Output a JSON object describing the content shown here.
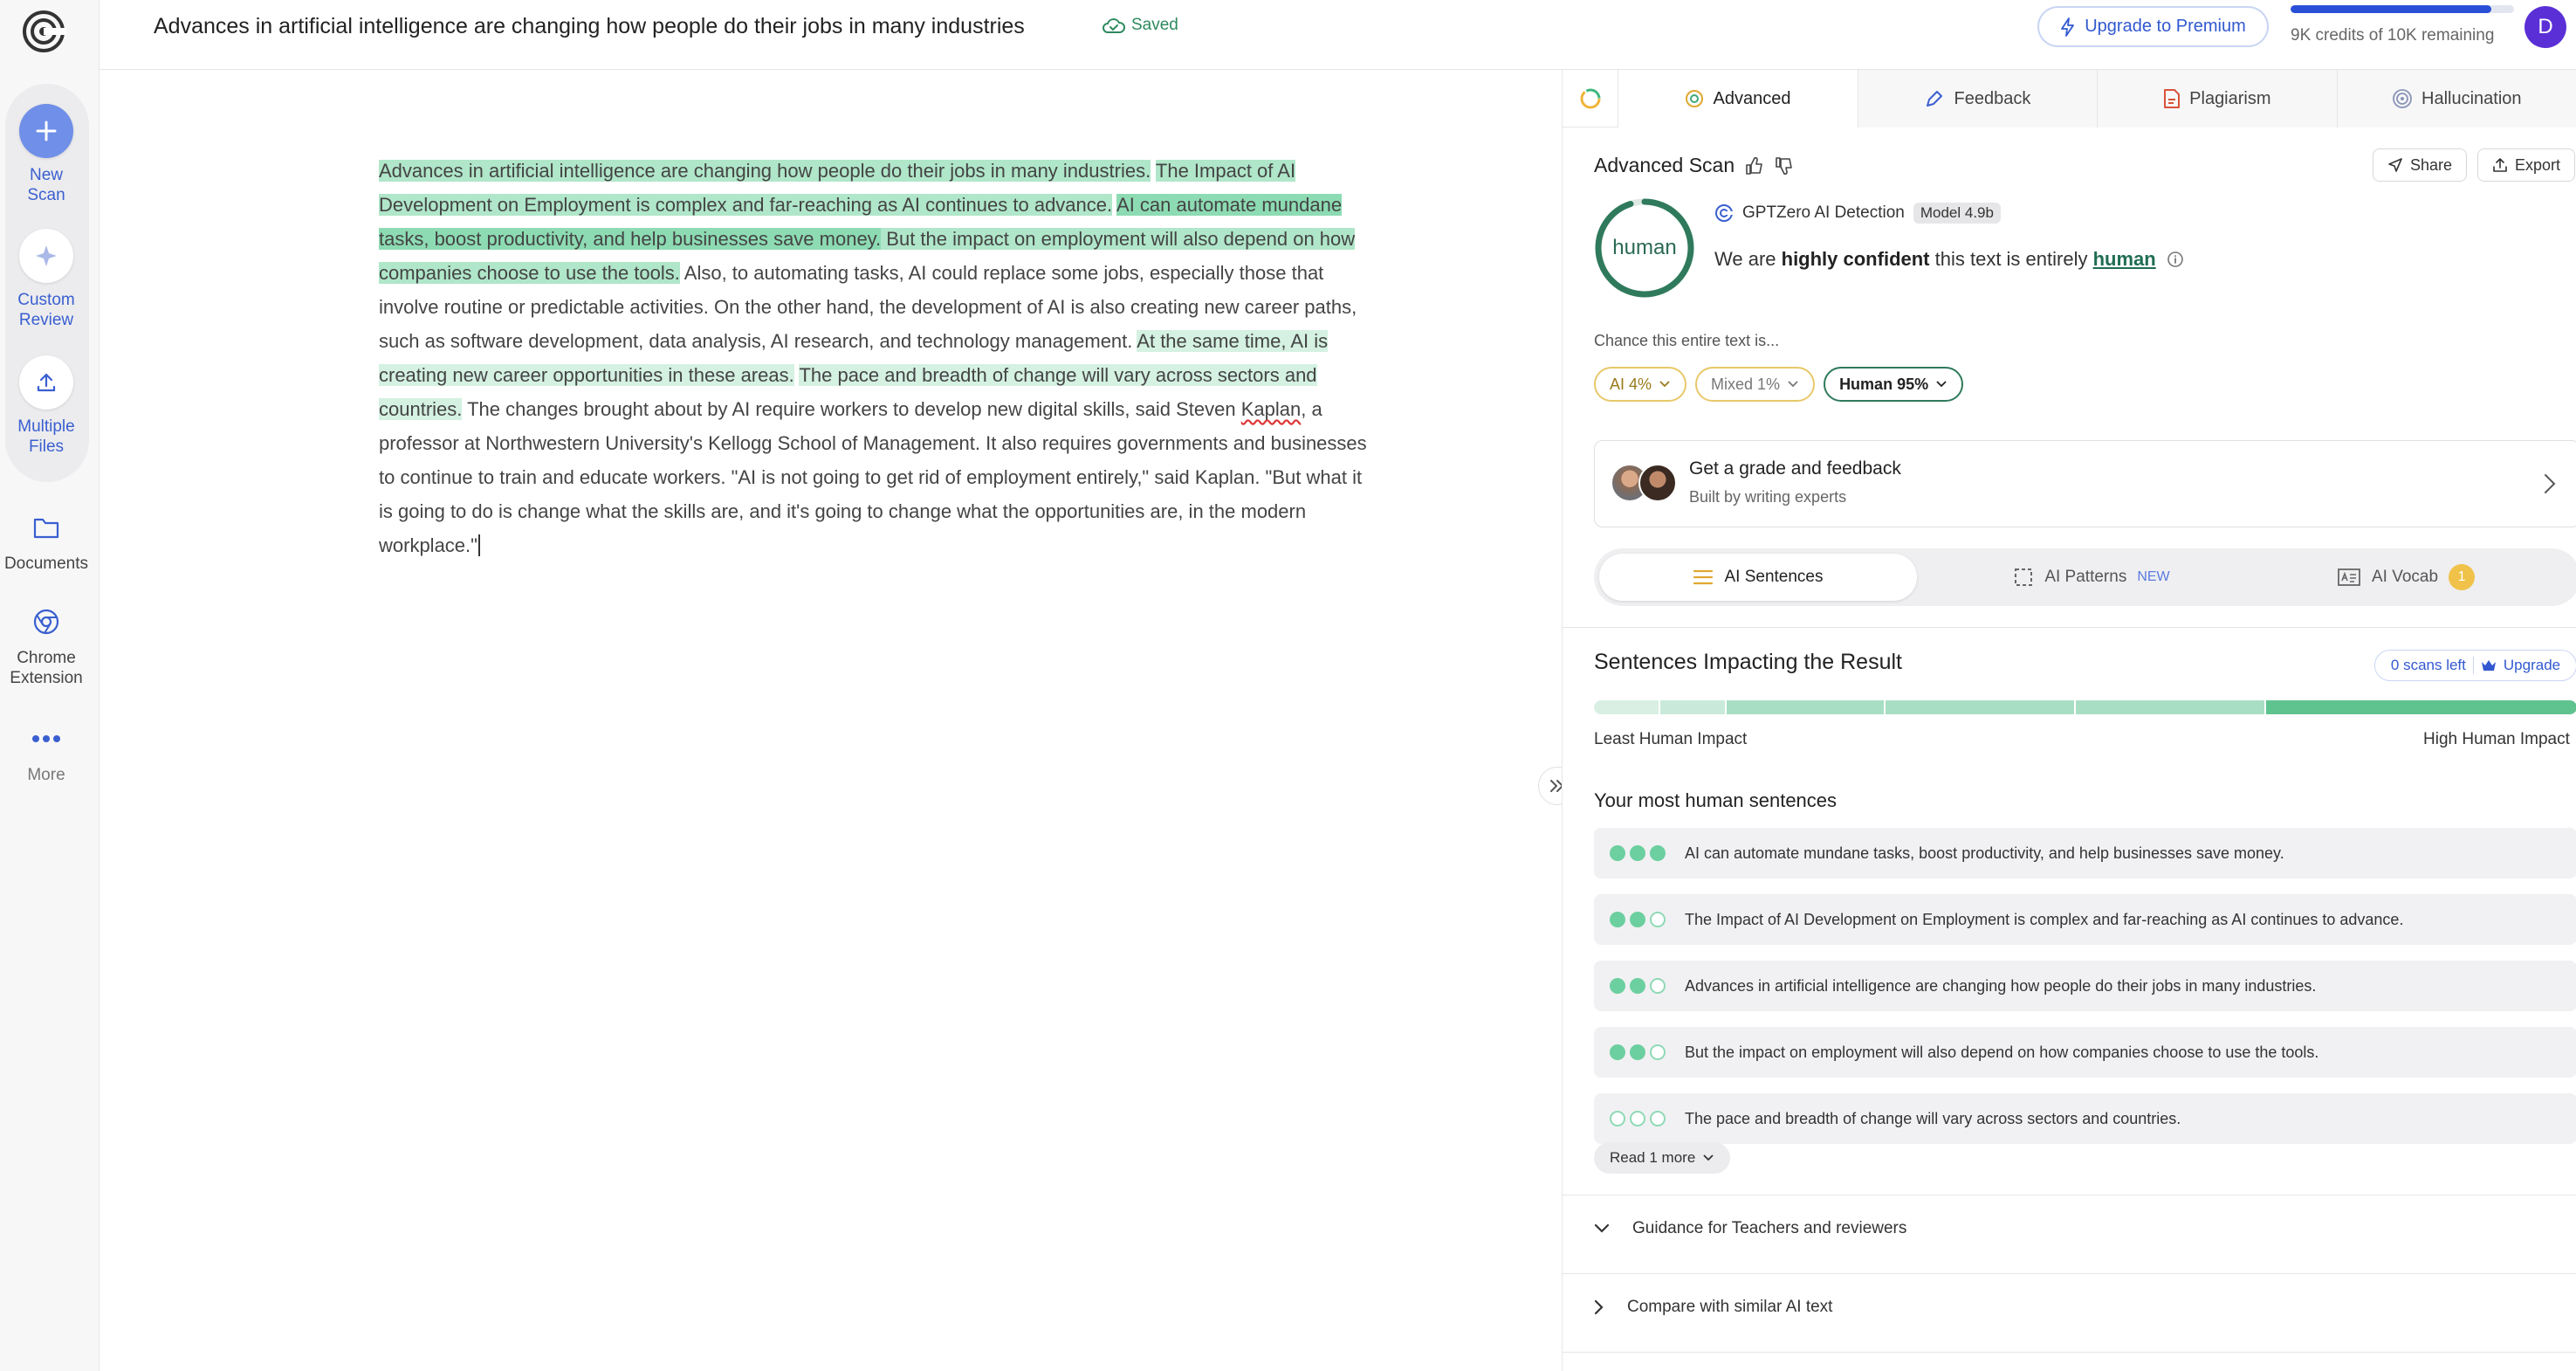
{
  "document": {
    "title": "Advances in artificial intelligence are changing how people do their jobs in many industries",
    "saved_label": "Saved"
  },
  "sidebar": {
    "items": [
      {
        "label_line1": "New",
        "label_line2": "Scan",
        "icon": "plus-icon"
      },
      {
        "label_line1": "Custom",
        "label_line2": "Review",
        "icon": "sparkle-icon"
      },
      {
        "label_line1": "Multiple",
        "label_line2": "Files",
        "icon": "upload-icon"
      },
      {
        "label_line1": "Documents",
        "label_line2": "",
        "icon": "folder-icon"
      },
      {
        "label_line1": "Chrome",
        "label_line2": "Extension",
        "icon": "chrome-icon"
      },
      {
        "label_line1": "More",
        "label_line2": "",
        "icon": "more-dots-icon"
      }
    ]
  },
  "header": {
    "upgrade_label": "Upgrade to Premium",
    "credits_text": "9K credits of 10K remaining",
    "credits_fraction": 0.9,
    "avatar_initial": "D"
  },
  "editor": {
    "segments": [
      {
        "text": "Advances in artificial intelligence are changing how people do their jobs in many industries.",
        "hl": "mid"
      },
      {
        "text": " ",
        "hl": "none"
      },
      {
        "text": "The Impact of AI Development on Employment is complex and far-reaching as AI continues to advance.",
        "hl": "mid"
      },
      {
        "text": " ",
        "hl": "none"
      },
      {
        "text": "AI can automate mundane tasks, boost productivity, and help businesses save money.",
        "hl": "dark"
      },
      {
        "text": " But the impact on employment will also depend on how companies choose to use the tools.",
        "hl": "mid"
      },
      {
        "text": " Also, to automating tasks, AI could replace some jobs, especially those that involve routine or predictable activities. On the other hand, the development of AI is also creating new career paths, such as software development, data analysis, AI research, and technology management. ",
        "hl": "none"
      },
      {
        "text": "At the same time, AI is creating new career opportunities in these areas.",
        "hl": "light"
      },
      {
        "text": " ",
        "hl": "none"
      },
      {
        "text": "The pace and breadth of change will vary across sectors and countries.",
        "hl": "light"
      },
      {
        "text": " The changes brought about by AI require workers to develop new digital skills, said Steven ",
        "hl": "none"
      },
      {
        "text": "Kaplan",
        "hl": "spell"
      },
      {
        "text": ", a professor at Northwestern University's Kellogg School of Management. It also requires governments and businesses to continue to train and educate workers. \"AI is not going to get rid of employment entirely,\" said Kaplan. \"But what it is going to do is change what the skills are, and it's going to change what the opportunities are, in the modern workplace.\"",
        "hl": "none"
      }
    ]
  },
  "panel": {
    "tabs": [
      {
        "label": "Advanced",
        "icon": "target-icon",
        "active": true
      },
      {
        "label": "Feedback",
        "icon": "pen-icon",
        "active": false
      },
      {
        "label": "Plagiarism",
        "icon": "document-icon",
        "active": false
      },
      {
        "label": "Hallucination",
        "icon": "spiral-icon",
        "active": false
      }
    ],
    "scan_title": "Advanced Scan",
    "share_label": "Share",
    "export_label": "Export",
    "result_label": "human",
    "detector_name": "GPTZero AI Detection",
    "model_label": "Model 4.9b",
    "confidence_pre": "We are ",
    "confidence_strong": "highly confident",
    "confidence_mid": " this text is entirely ",
    "confidence_result": "human",
    "chance_label": "Chance this entire text is...",
    "chips": [
      {
        "label": "AI 4%",
        "value": 4
      },
      {
        "label": "Mixed 1%",
        "value": 1
      },
      {
        "label": "Human 95%",
        "value": 95
      }
    ],
    "grade_title": "Get a grade and feedback",
    "grade_sub": "Built by writing experts",
    "segments": [
      {
        "label": "AI Sentences",
        "active": true
      },
      {
        "label": "AI Patterns",
        "tag": "NEW"
      },
      {
        "label": "AI Vocab",
        "count": "1"
      }
    ],
    "impact_title": "Sentences Impacting the Result",
    "scans_left": "0 scans left",
    "upgrade_small": "Upgrade",
    "impact_scale": {
      "least": "Least Human Impact",
      "high": "High Human Impact"
    },
    "most_human_title": "Your most human sentences",
    "sentences": [
      {
        "text": "AI can automate mundane tasks, boost productivity, and help businesses save money.",
        "level": 3
      },
      {
        "text": "The Impact of AI Development on Employment is complex and far-reaching as AI continues to advance.",
        "level": 2
      },
      {
        "text": "Advances in artificial intelligence are changing how people do their jobs in many industries.",
        "level": 2
      },
      {
        "text": "But the impact on employment will also depend on how companies choose to use the tools.",
        "level": 2
      },
      {
        "text": "The pace and breadth of change will vary across sectors and countries.",
        "level": 0
      }
    ],
    "read_more_label": "Read 1 more",
    "accordions": [
      {
        "label": "Guidance for Teachers and reviewers",
        "expanded": true
      },
      {
        "label": "Compare with similar AI text",
        "expanded": false
      }
    ]
  },
  "colors": {
    "accent": "#2a4fd7",
    "human_green": "#2f7a5c",
    "highlight_dark": "#8ddbb3",
    "highlight_light": "#d4f1e2",
    "ai_yellow": "#e8c86a"
  }
}
